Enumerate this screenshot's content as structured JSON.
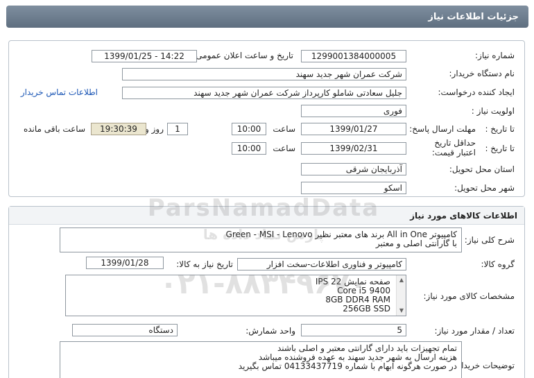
{
  "title": "جزئیات اطلاعات نیاز",
  "sec1": {
    "need_number_label": "شماره نیاز:",
    "need_number": "1299001384000005",
    "announce_label": "تاریخ و ساعت اعلان عمومی:",
    "announce_value": "1399/01/25 - 14:22",
    "buyer_label": "نام دستگاه خریدار:",
    "buyer_value": "شرکت عمران شهر جدید سهند",
    "creator_label": "ایجاد کننده درخواست:",
    "creator_value": "جلیل سعادتی شاملو کارپرداز شرکت عمران شهر جدید سهند",
    "contact_link": "اطلاعات تماس خریدار",
    "priority_label": "اولویت نیاز :",
    "priority_value": "فوری",
    "deadline_label": "مهلت ارسال پاسخ:",
    "to_date_label": "تا تاریخ :",
    "deadline_date": "1399/01/27",
    "time_label": "ساعت",
    "deadline_time": "10:00",
    "days": "1",
    "days_label": "روز و",
    "remaining": "19:30:39",
    "remaining_label": "ساعت باقی مانده",
    "validity_label": "حداقل تاریخ اعتبار قیمت:",
    "validity_to_label": "تا تاریخ :",
    "validity_date": "1399/02/31",
    "validity_time_label": "ساعت",
    "validity_time": "10:00",
    "province_label": "استان محل تحویل:",
    "province_value": "آذربایجان شرقی",
    "city_label": "شهر محل تحویل:",
    "city_value": "اسکو"
  },
  "sec2": {
    "header": "اطلاعات کالاهای مورد نیاز",
    "summary_label": "شرح کلی نیاز:",
    "summary_line1": "کامپیوتر All in One برند های معتبر نظیر Green - MSI - Lenovo",
    "summary_line2": "با گارانتی اصلی و معتبر",
    "group_label": "گروه کالا:",
    "group_value": "کامپیوتر و فناوری اطلاعات-سخت افزار",
    "need_date_label": "تاریخ نیاز به کالا:",
    "need_date": "1399/01/28",
    "specs_label": "مشخصات کالای مورد نیاز:",
    "specs": [
      "صفحه نمایش IPS 22",
      "Core i5 9400",
      "8GB DDR4 RAM",
      "256GB SSD"
    ],
    "qty_label": "تعداد / مقدار مورد نیاز:",
    "qty_value": "5",
    "unit_label": "واحد شمارش:",
    "unit_value": "دستگاه",
    "notes_label": "توضیحات خریدار:",
    "notes": [
      "تمام تجهیزات باید دارای گارانتی معتبر و اصلی باشند",
      "هزینه ارسال به شهر جدید سهند به عهده فروشنده میباشد",
      "در صورت هرگونه ابهام با شماره 04133437719 تماس بگیرید"
    ]
  },
  "watermark": {
    "line1": "ParsNamadData",
    "line2": "پارس نماد داده ها",
    "line3": "۰۲۱-۸۸۳۴۹۶۷۰"
  }
}
